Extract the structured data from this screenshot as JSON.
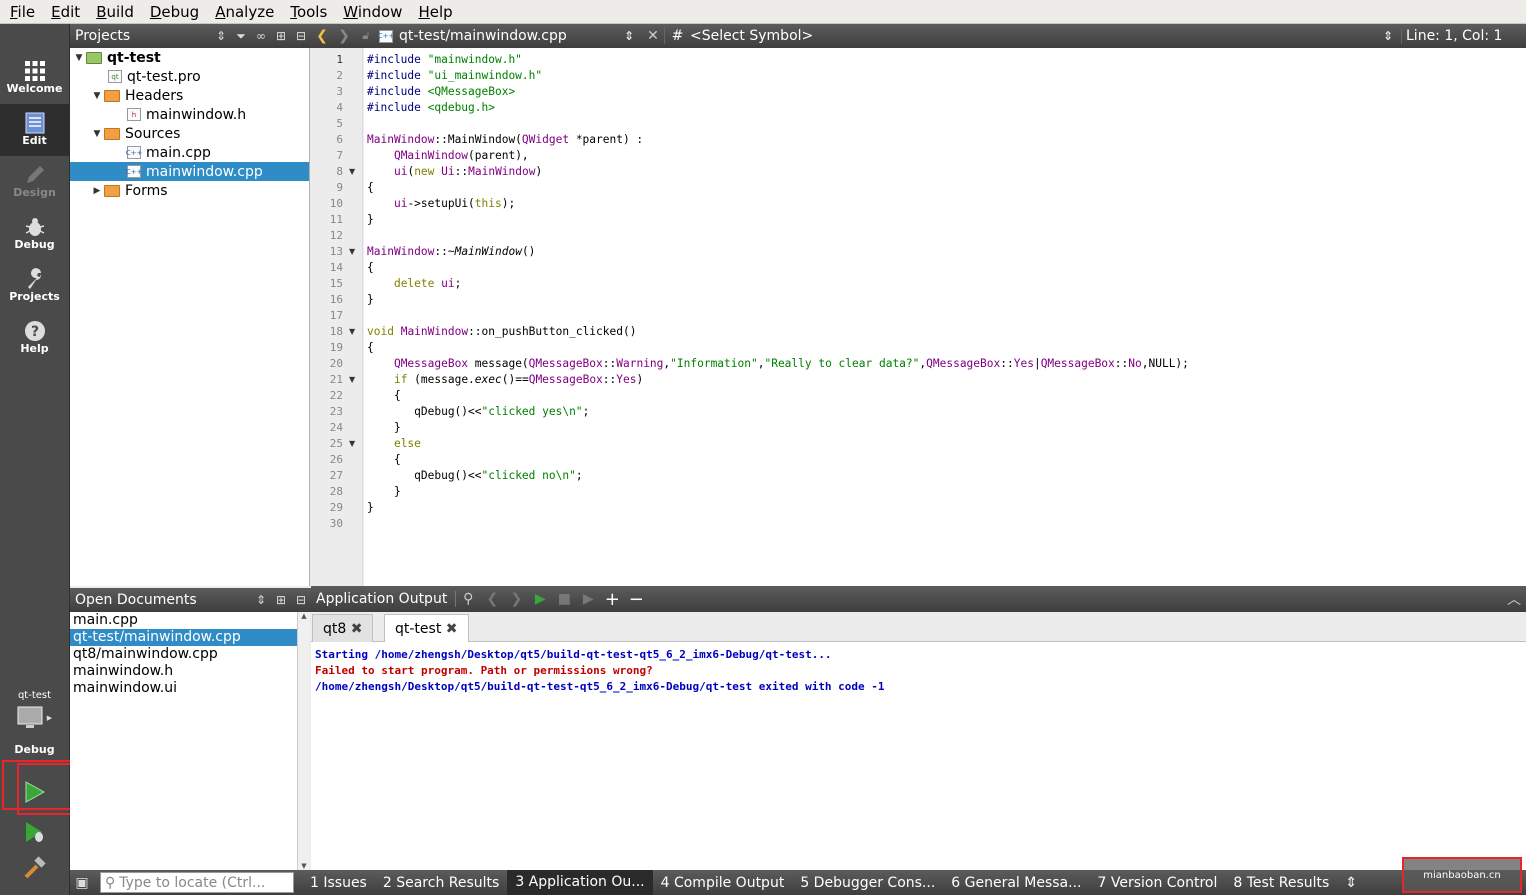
{
  "menu": [
    "File",
    "Edit",
    "Build",
    "Debug",
    "Analyze",
    "Tools",
    "Window",
    "Help"
  ],
  "modes": [
    {
      "label": "Welcome",
      "icon": "grid-icon",
      "state": "normal"
    },
    {
      "label": "Edit",
      "icon": "document-icon",
      "state": "active"
    },
    {
      "label": "Design",
      "icon": "pencil-icon",
      "state": "disabled"
    },
    {
      "label": "Debug",
      "icon": "bug-icon",
      "state": "normal"
    },
    {
      "label": "Projects",
      "icon": "wrench-icon",
      "state": "normal"
    },
    {
      "label": "Help",
      "icon": "question-icon",
      "state": "normal"
    }
  ],
  "kit": {
    "project": "qt-test",
    "config": "Debug"
  },
  "projects_panel": {
    "title": "Projects"
  },
  "tree": [
    {
      "label": "qt-test",
      "type": "project",
      "expanded": true,
      "bold": true
    },
    {
      "label": "qt-test.pro",
      "type": "pro"
    },
    {
      "label": "Headers",
      "type": "folder",
      "expanded": true
    },
    {
      "label": "mainwindow.h",
      "type": "h"
    },
    {
      "label": "Sources",
      "type": "folder",
      "expanded": true
    },
    {
      "label": "main.cpp",
      "type": "cpp"
    },
    {
      "label": "mainwindow.cpp",
      "type": "cpp",
      "selected": true
    },
    {
      "label": "Forms",
      "type": "folder",
      "expanded": false
    }
  ],
  "open_documents": {
    "title": "Open Documents",
    "items": [
      "main.cpp",
      "qt-test/mainwindow.cpp",
      "qt8/mainwindow.cpp",
      "mainwindow.h",
      "mainwindow.ui"
    ],
    "selected_index": 1
  },
  "editor": {
    "file": "qt-test/mainwindow.cpp",
    "hash": "#",
    "symbol": "<Select Symbol>",
    "position": "Line: 1, Col: 1",
    "lines": [
      [
        [
          "pp",
          "#include "
        ],
        [
          "st",
          "\"mainwindow.h\""
        ]
      ],
      [
        [
          "pp",
          "#include "
        ],
        [
          "st",
          "\"ui_mainwindow.h\""
        ]
      ],
      [
        [
          "pp",
          "#include "
        ],
        [
          "st",
          "<QMessageBox>"
        ]
      ],
      [
        [
          "pp",
          "#include "
        ],
        [
          "st",
          "<qdebug.h>"
        ]
      ],
      [],
      [
        [
          "ty",
          "MainWindow"
        ],
        [
          "",
          "::MainWindow("
        ],
        [
          "ty",
          "QWidget"
        ],
        [
          "",
          " *parent) :"
        ]
      ],
      [
        [
          "",
          "    "
        ],
        [
          "ty",
          "QMainWindow"
        ],
        [
          "",
          "(parent),"
        ]
      ],
      [
        [
          "",
          "    "
        ],
        [
          "ty",
          "ui"
        ],
        [
          "",
          "("
        ],
        [
          "kw",
          "new"
        ],
        [
          "",
          " "
        ],
        [
          "ty",
          "Ui"
        ],
        [
          "",
          "::"
        ],
        [
          "ty",
          "MainWindow"
        ],
        [
          "",
          ")"
        ]
      ],
      [
        [
          "",
          "{"
        ]
      ],
      [
        [
          "",
          "    "
        ],
        [
          "ty",
          "ui"
        ],
        [
          "",
          "->setupUi("
        ],
        [
          "kw",
          "this"
        ],
        [
          "",
          ");"
        ]
      ],
      [
        [
          "",
          "}"
        ]
      ],
      [],
      [
        [
          "ty",
          "MainWindow"
        ],
        [
          "",
          "::~"
        ],
        [
          "it",
          "MainWindow"
        ],
        [
          "",
          "()"
        ]
      ],
      [
        [
          "",
          "{"
        ]
      ],
      [
        [
          "",
          "    "
        ],
        [
          "kw",
          "delete"
        ],
        [
          "",
          " "
        ],
        [
          "ty",
          "ui"
        ],
        [
          "",
          ";"
        ]
      ],
      [
        [
          "",
          "}"
        ]
      ],
      [],
      [
        [
          "kw",
          "void"
        ],
        [
          "",
          " "
        ],
        [
          "ty",
          "MainWindow"
        ],
        [
          "",
          "::on_pushButton_clicked()"
        ]
      ],
      [
        [
          "",
          "{"
        ]
      ],
      [
        [
          "",
          "    "
        ],
        [
          "ty",
          "QMessageBox"
        ],
        [
          "",
          " message("
        ],
        [
          "ty",
          "QMessageBox"
        ],
        [
          "",
          "::"
        ],
        [
          "ty",
          "Warning"
        ],
        [
          "",
          ","
        ],
        [
          "st",
          "\"Information\""
        ],
        [
          "",
          ","
        ],
        [
          "st",
          "\"Really to clear data?\""
        ],
        [
          "",
          ","
        ],
        [
          "ty",
          "QMessageBox"
        ],
        [
          "",
          "::"
        ],
        [
          "ty",
          "Yes"
        ],
        [
          "",
          "|"
        ],
        [
          "ty",
          "QMessageBox"
        ],
        [
          "",
          "::"
        ],
        [
          "ty",
          "No"
        ],
        [
          "",
          ",NULL);"
        ]
      ],
      [
        [
          "",
          "    "
        ],
        [
          "kw",
          "if"
        ],
        [
          "",
          " (message."
        ],
        [
          "it",
          "exec"
        ],
        [
          "",
          "()=="
        ],
        [
          "ty",
          "QMessageBox"
        ],
        [
          "",
          "::"
        ],
        [
          "ty",
          "Yes"
        ],
        [
          "",
          ")"
        ]
      ],
      [
        [
          "",
          "    {"
        ]
      ],
      [
        [
          "",
          "       qDebug()<<"
        ],
        [
          "st",
          "\"clicked yes\\n\""
        ],
        [
          "",
          ";"
        ]
      ],
      [
        [
          "",
          "    }"
        ]
      ],
      [
        [
          "",
          "    "
        ],
        [
          "kw",
          "else"
        ]
      ],
      [
        [
          "",
          "    {"
        ]
      ],
      [
        [
          "",
          "       qDebug()<<"
        ],
        [
          "st",
          "\"clicked no\\n\""
        ],
        [
          "",
          ";"
        ]
      ],
      [
        [
          "",
          "    }"
        ]
      ],
      [
        [
          "",
          "}"
        ]
      ],
      []
    ],
    "fold_lines": [
      8,
      13,
      18,
      21,
      25
    ]
  },
  "output_panel": {
    "title": "Application Output",
    "tabs": [
      {
        "label": "qt8"
      },
      {
        "label": "qt-test"
      }
    ],
    "active_tab": 1,
    "lines": [
      {
        "text": "Starting /home/zhengsh/Desktop/qt5/build-qt-test-qt5_6_2_imx6-Debug/qt-test...",
        "color": "#0000c0"
      },
      {
        "text": "Failed to start program. Path or permissions wrong?",
        "color": "#c00000"
      },
      {
        "text": "/home/zhengsh/Desktop/qt5/build-qt-test-qt5_6_2_imx6-Debug/qt-test exited with code -1",
        "color": "#0000c0"
      }
    ]
  },
  "statusbar": {
    "locate_placeholder": "Type to locate (Ctrl...",
    "items": [
      "1  Issues",
      "2  Search Results",
      "3  Application Ou...",
      "4  Compile Output",
      "5  Debugger Cons...",
      "6  General Messa...",
      "7  Version Control",
      "8  Test Results"
    ],
    "active_index": 2
  },
  "watermark": {
    "text": "mianbaoban.cn"
  },
  "colors": {
    "selection": "#308cc6",
    "run_green": "#3aa63a",
    "highlight_box": "#e8262a"
  }
}
